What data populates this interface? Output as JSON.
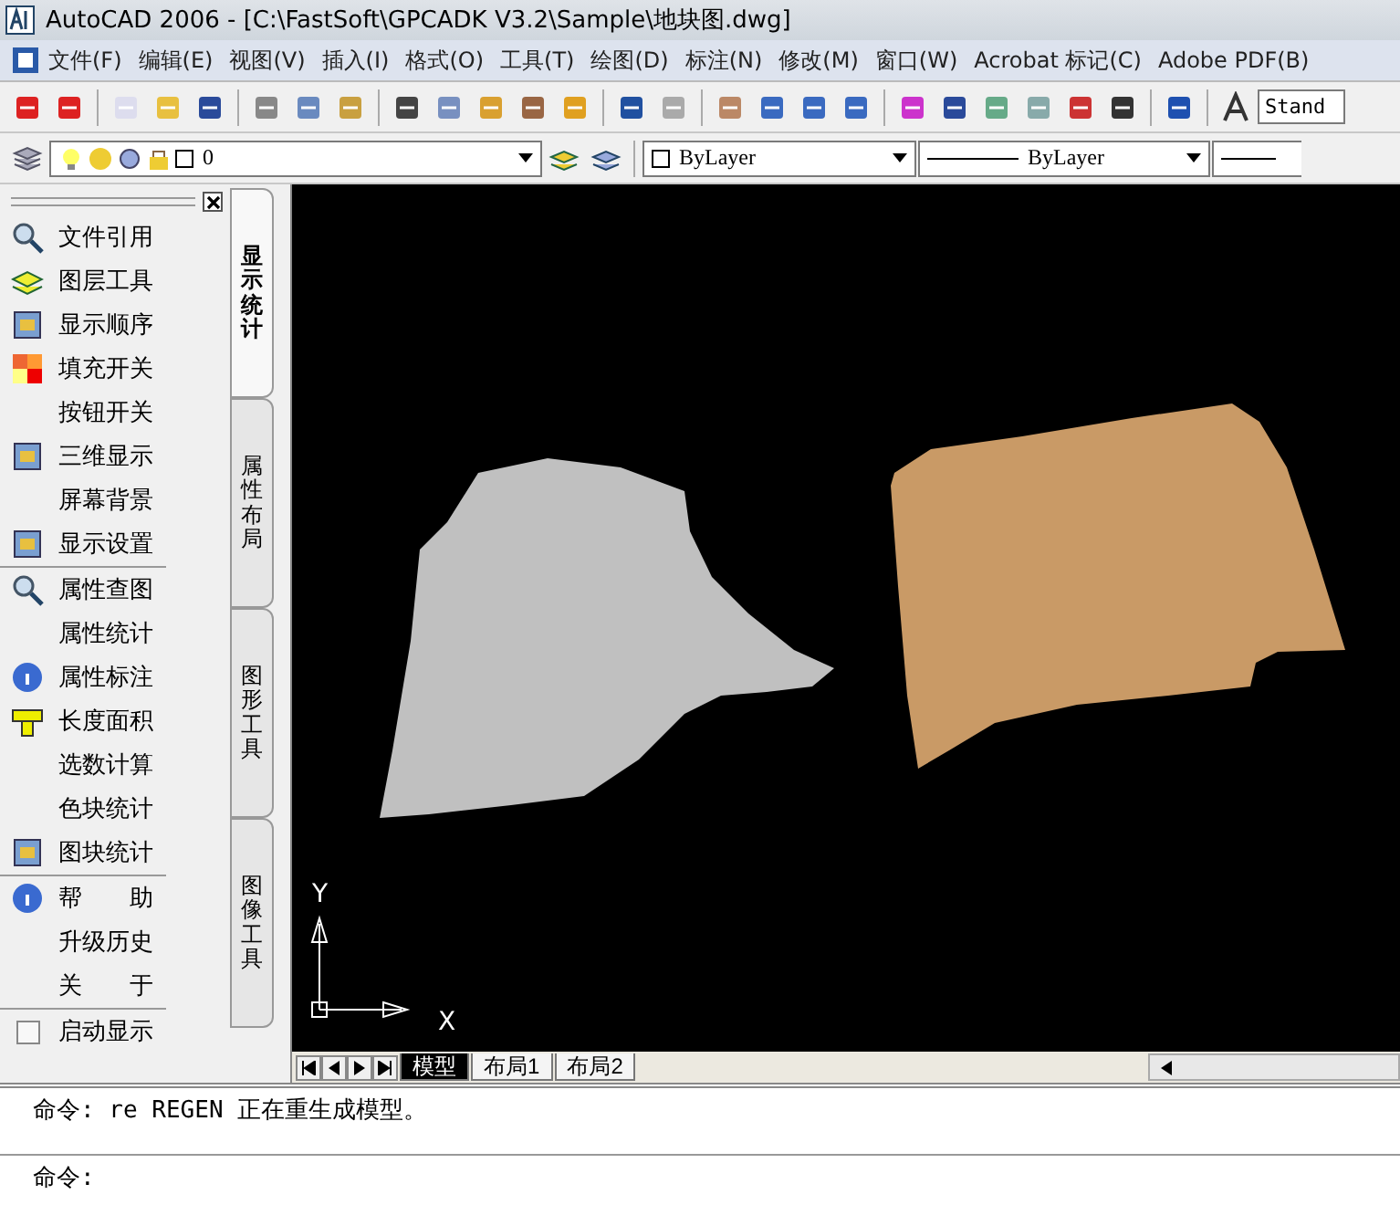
{
  "window": {
    "title": "AutoCAD 2006 - [C:\\FastSoft\\GPCADK V3.2\\Sample\\地块图.dwg]"
  },
  "menu": [
    "文件(F)",
    "编辑(E)",
    "视图(V)",
    "插入(I)",
    "格式(O)",
    "工具(T)",
    "绘图(D)",
    "标注(N)",
    "修改(M)",
    "窗口(W)",
    "Acrobat 标记(C)",
    "Adobe PDF(B)"
  ],
  "toolbar": {
    "text_style": "Stand"
  },
  "properties_bar": {
    "layer": "0",
    "color_setting": "ByLayer",
    "linetype": "ByLayer"
  },
  "sidebar": {
    "groups": [
      {
        "items": [
          "文件引用",
          "图层工具",
          "显示顺序",
          "填充开关",
          "按钮开关",
          "三维显示",
          "屏幕背景",
          "显示设置"
        ]
      },
      {
        "items": [
          "属性查图",
          "属性统计",
          "属性标注",
          "长度面积",
          "选数计算",
          "色块统计",
          "图块统计"
        ]
      },
      {
        "items": [
          "帮　　助",
          "升级历史",
          "关　　于"
        ]
      }
    ],
    "startup_checkbox": {
      "label": "启动显示",
      "checked": false
    },
    "tabs": [
      {
        "label": "显示统计",
        "selected": true
      },
      {
        "label": "属性布局",
        "selected": false
      },
      {
        "label": "图形工具",
        "selected": false
      },
      {
        "label": "图像工具",
        "selected": false
      }
    ]
  },
  "canvas": {
    "ucs": {
      "y_label": "Y",
      "x_label": "X"
    }
  },
  "layout_tabs": [
    {
      "label": "模型",
      "selected": true
    },
    {
      "label": "布局1",
      "selected": false
    },
    {
      "label": "布局2",
      "selected": false
    }
  ],
  "command_lines": [
    "命令: re REGEN 正在重生成模型。",
    "命令:"
  ]
}
